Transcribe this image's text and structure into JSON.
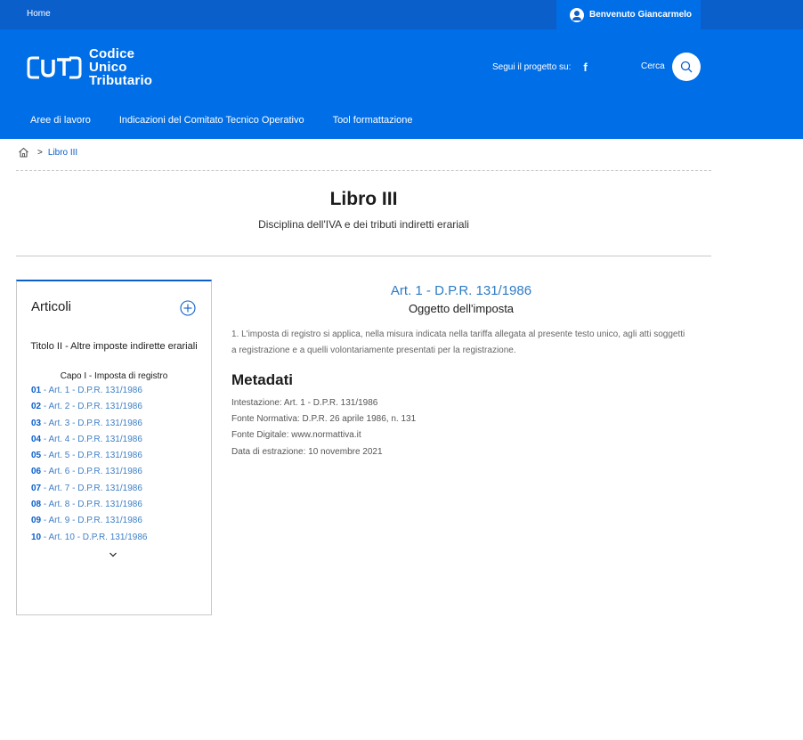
{
  "topbar": {
    "home_label": "Home",
    "user_label": "Benvenuto Giancarmelo"
  },
  "header": {
    "logo_mark": "UT",
    "logo_lines": [
      "Codice",
      "Unico",
      "Tributario"
    ],
    "social_label": "Segui il progetto su:",
    "social_icon": "facebook-icon",
    "search_label": "Cerca",
    "nav": [
      "Aree di lavoro",
      "Indicazioni del Comitato Tecnico Operativo",
      "Tool formattazione"
    ]
  },
  "breadcrumb": {
    "separator": ">",
    "current": "Libro III"
  },
  "page": {
    "title": "Libro III",
    "subtitle": "Disciplina dell'IVA e dei tributi indiretti erariali"
  },
  "sidebar": {
    "heading": "Articoli",
    "titolo": "Titolo II - Altre imposte indirette erariali",
    "capo": "Capo I - Imposta di registro",
    "items": [
      {
        "num": "01",
        "label": " - Art. 1 - D.P.R. 131/1986"
      },
      {
        "num": "02",
        "label": " - Art. 2 - D.P.R. 131/1986"
      },
      {
        "num": "03",
        "label": " - Art. 3 - D.P.R. 131/1986"
      },
      {
        "num": "04",
        "label": " - Art. 4 - D.P.R. 131/1986"
      },
      {
        "num": "05",
        "label": " - Art. 5 - D.P.R. 131/1986"
      },
      {
        "num": "06",
        "label": " - Art. 6 - D.P.R. 131/1986"
      },
      {
        "num": "07",
        "label": " - Art. 7 - D.P.R. 131/1986"
      },
      {
        "num": "08",
        "label": " - Art. 8 - D.P.R. 131/1986"
      },
      {
        "num": "09",
        "label": " - Art. 9 - D.P.R. 131/1986"
      },
      {
        "num": "10",
        "label": " - Art. 10 - D.P.R. 131/1986"
      }
    ]
  },
  "article": {
    "title": "Art. 1 - D.P.R. 131/1986",
    "subtitle": "Oggetto dell'imposta",
    "body": "1. L'imposta di registro si applica, nella misura indicata nella tariffa allegata al presente testo unico, agli atti soggetti a registrazione e a quelli volontariamente presentati per la registrazione."
  },
  "metadata": {
    "heading": "Metadati",
    "items": [
      "Intestazione: Art. 1 - D.P.R. 131/1986",
      "Fonte Normativa: D.P.R. 26 aprile 1986, n. 131",
      "Fonte Digitale: www.normattiva.it",
      "Data di estrazione: 10 novembre 2021"
    ]
  },
  "colors": {
    "brand_blue": "#006ee6",
    "topbar_blue": "#0b5fcb",
    "link_blue": "#2c7bc6"
  }
}
